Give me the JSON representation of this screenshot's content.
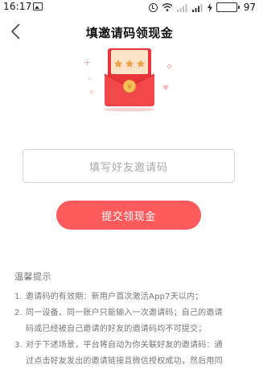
{
  "status_bar": {
    "time": "16:17",
    "battery_pct": "97",
    "battery_level": 0.97,
    "battery_color": "#3fbf4f"
  },
  "nav": {
    "title": "填邀请码领现金",
    "back_icon": "chevron-left-icon"
  },
  "envelope": {
    "stars": "★ ★ ★",
    "body_color": "#f0474b",
    "flap_color": "#e7353a"
  },
  "form": {
    "invite_placeholder": "填写好友邀请码",
    "submit_label": "提交领现金",
    "accent_color": "#ff5a5c"
  },
  "tips": {
    "title": "温馨提示",
    "items": [
      {
        "num": "1.",
        "lines": [
          "邀请码的有效期：新用户首次激活App7天以内；"
        ]
      },
      {
        "num": "2.",
        "lines": [
          "同一设备、同一账户只能输入一次邀请码；自己的邀请",
          "码或已经被自己邀请的好友的邀请码均不可提交；"
        ]
      },
      {
        "num": "3.",
        "lines": [
          "对于下述场景，平台将自动为你关联好友的邀请码：通",
          "过点击好友发出的邀请链接且微信授权成功，然后用同"
        ]
      }
    ]
  }
}
